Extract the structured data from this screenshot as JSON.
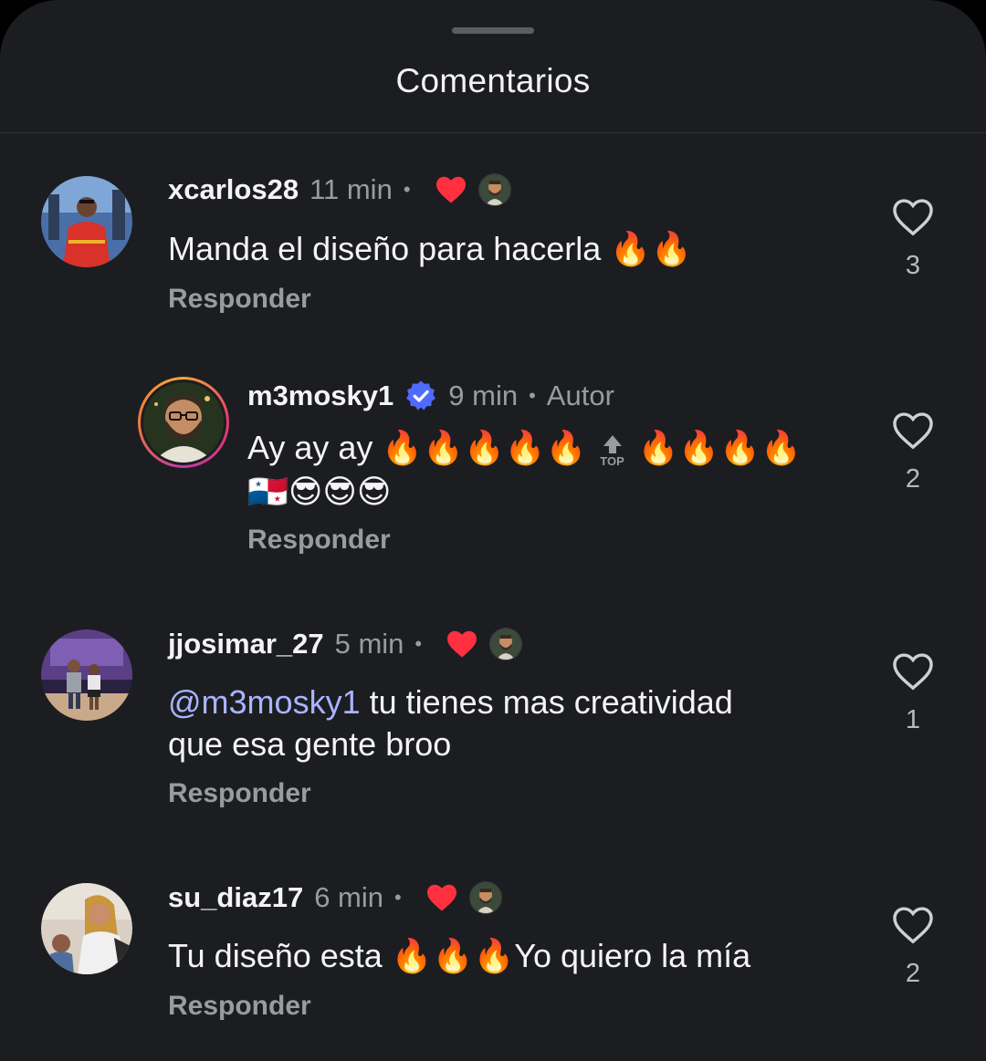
{
  "header": {
    "title": "Comentarios"
  },
  "colors": {
    "background": "#1c1d20",
    "mention": "#a9b4ff",
    "like_red": "#ff3040",
    "verified_blue": "#4f6bff"
  },
  "comments": [
    {
      "username": "xcarlos28",
      "time": "11 min",
      "separator": "•",
      "liked_by_author": true,
      "text": "Manda el diseño para hacerla 🔥🔥",
      "reply_label": "Responder",
      "like_count": "3"
    },
    {
      "username": "m3mosky1",
      "verified": true,
      "time": "9 min",
      "separator": "•",
      "author_label": "Autor",
      "text_before": "Ay ay ay 🔥🔥🔥🔥🔥",
      "top_label": "TOP",
      "text_after": "🔥🔥🔥🔥",
      "text_line2": "🇵🇦😎😎😎",
      "reply_label": "Responder",
      "like_count": "2"
    },
    {
      "username": "jjosimar_27",
      "time": "5 min",
      "separator": "•",
      "liked_by_author": true,
      "mention": "@m3mosky1",
      "text_rest": " tu tienes mas creatividad",
      "text_line2": "que esa gente broo",
      "reply_label": "Responder",
      "like_count": "1"
    },
    {
      "username": "su_diaz17",
      "time": "6 min",
      "separator": "•",
      "liked_by_author": true,
      "text": "Tu diseño esta 🔥🔥🔥Yo quiero la mía",
      "reply_label": "Responder",
      "like_count": "2"
    }
  ]
}
